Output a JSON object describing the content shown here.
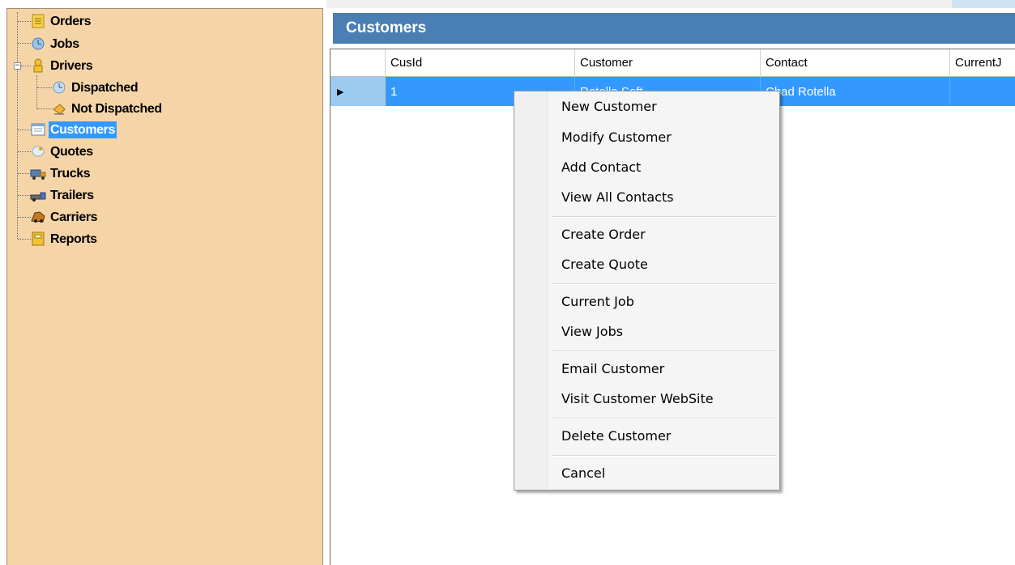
{
  "tree": {
    "items": [
      {
        "label": "Orders",
        "icon": "orders-icon",
        "selected": false
      },
      {
        "label": "Jobs",
        "icon": "jobs-icon",
        "selected": false
      },
      {
        "label": "Drivers",
        "icon": "drivers-icon",
        "selected": false,
        "expanded": true
      },
      {
        "label": "Dispatched",
        "icon": "dispatched-icon",
        "selected": false
      },
      {
        "label": "Not Dispatched",
        "icon": "not-dispatched-icon",
        "selected": false
      },
      {
        "label": "Customers",
        "icon": "customers-icon",
        "selected": true
      },
      {
        "label": "Quotes",
        "icon": "quotes-icon",
        "selected": false
      },
      {
        "label": "Trucks",
        "icon": "trucks-icon",
        "selected": false
      },
      {
        "label": "Trailers",
        "icon": "trailers-icon",
        "selected": false
      },
      {
        "label": "Carriers",
        "icon": "carriers-icon",
        "selected": false
      },
      {
        "label": "Reports",
        "icon": "reports-icon",
        "selected": false
      }
    ],
    "expander_symbol": "−"
  },
  "panel": {
    "title": "Customers"
  },
  "grid": {
    "columns": [
      "CusId",
      "Customer",
      "Contact",
      "CurrentJ"
    ],
    "rows": [
      {
        "CusId": "1",
        "Customer": "Rotella Soft",
        "Contact": "Chad Rotella",
        "CurrentJ": ""
      }
    ],
    "row_indicator": "▶"
  },
  "context_menu": {
    "groups": [
      [
        "New Customer",
        "Modify Customer",
        "Add Contact",
        "View All Contacts"
      ],
      [
        "Create Order",
        "Create Quote"
      ],
      [
        "Current Job",
        "View Jobs"
      ],
      [
        "Email Customer",
        "Visit Customer WebSite"
      ],
      [
        "Delete Customer"
      ],
      [
        "Cancel"
      ]
    ]
  },
  "colors": {
    "tree_background": "#f5d5a8",
    "header_blue": "#4a7fb3",
    "selection_blue": "#3399ff",
    "row_header_blue": "#9ccbf2"
  }
}
